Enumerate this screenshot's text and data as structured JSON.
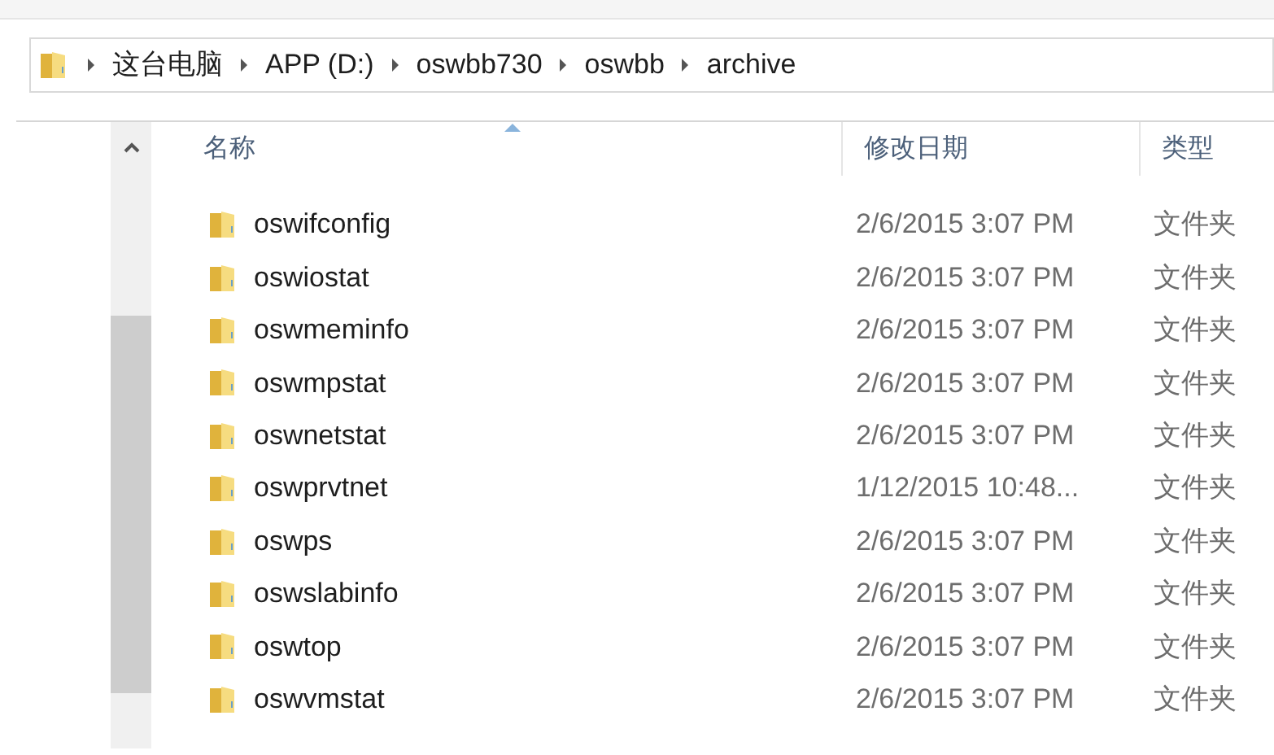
{
  "breadcrumb": [
    {
      "label": "这台电脑"
    },
    {
      "label": "APP (D:)"
    },
    {
      "label": "oswbb730"
    },
    {
      "label": "oswbb"
    },
    {
      "label": "archive"
    }
  ],
  "columns": [
    {
      "label": "名称",
      "sorted": true
    },
    {
      "label": "修改日期",
      "sorted": false
    },
    {
      "label": "类型",
      "sorted": false
    }
  ],
  "rows": [
    {
      "name": "oswifconfig",
      "date": "2/6/2015 3:07 PM",
      "type": "文件夹"
    },
    {
      "name": "oswiostat",
      "date": "2/6/2015 3:07 PM",
      "type": "文件夹"
    },
    {
      "name": "oswmeminfo",
      "date": "2/6/2015 3:07 PM",
      "type": "文件夹"
    },
    {
      "name": "oswmpstat",
      "date": "2/6/2015 3:07 PM",
      "type": "文件夹"
    },
    {
      "name": "oswnetstat",
      "date": "2/6/2015 3:07 PM",
      "type": "文件夹"
    },
    {
      "name": "oswprvtnet",
      "date": "1/12/2015 10:48...",
      "type": "文件夹"
    },
    {
      "name": "oswps",
      "date": "2/6/2015 3:07 PM",
      "type": "文件夹"
    },
    {
      "name": "oswslabinfo",
      "date": "2/6/2015 3:07 PM",
      "type": "文件夹"
    },
    {
      "name": "oswtop",
      "date": "2/6/2015 3:07 PM",
      "type": "文件夹"
    },
    {
      "name": "oswvmstat",
      "date": "2/6/2015 3:07 PM",
      "type": "文件夹"
    }
  ]
}
